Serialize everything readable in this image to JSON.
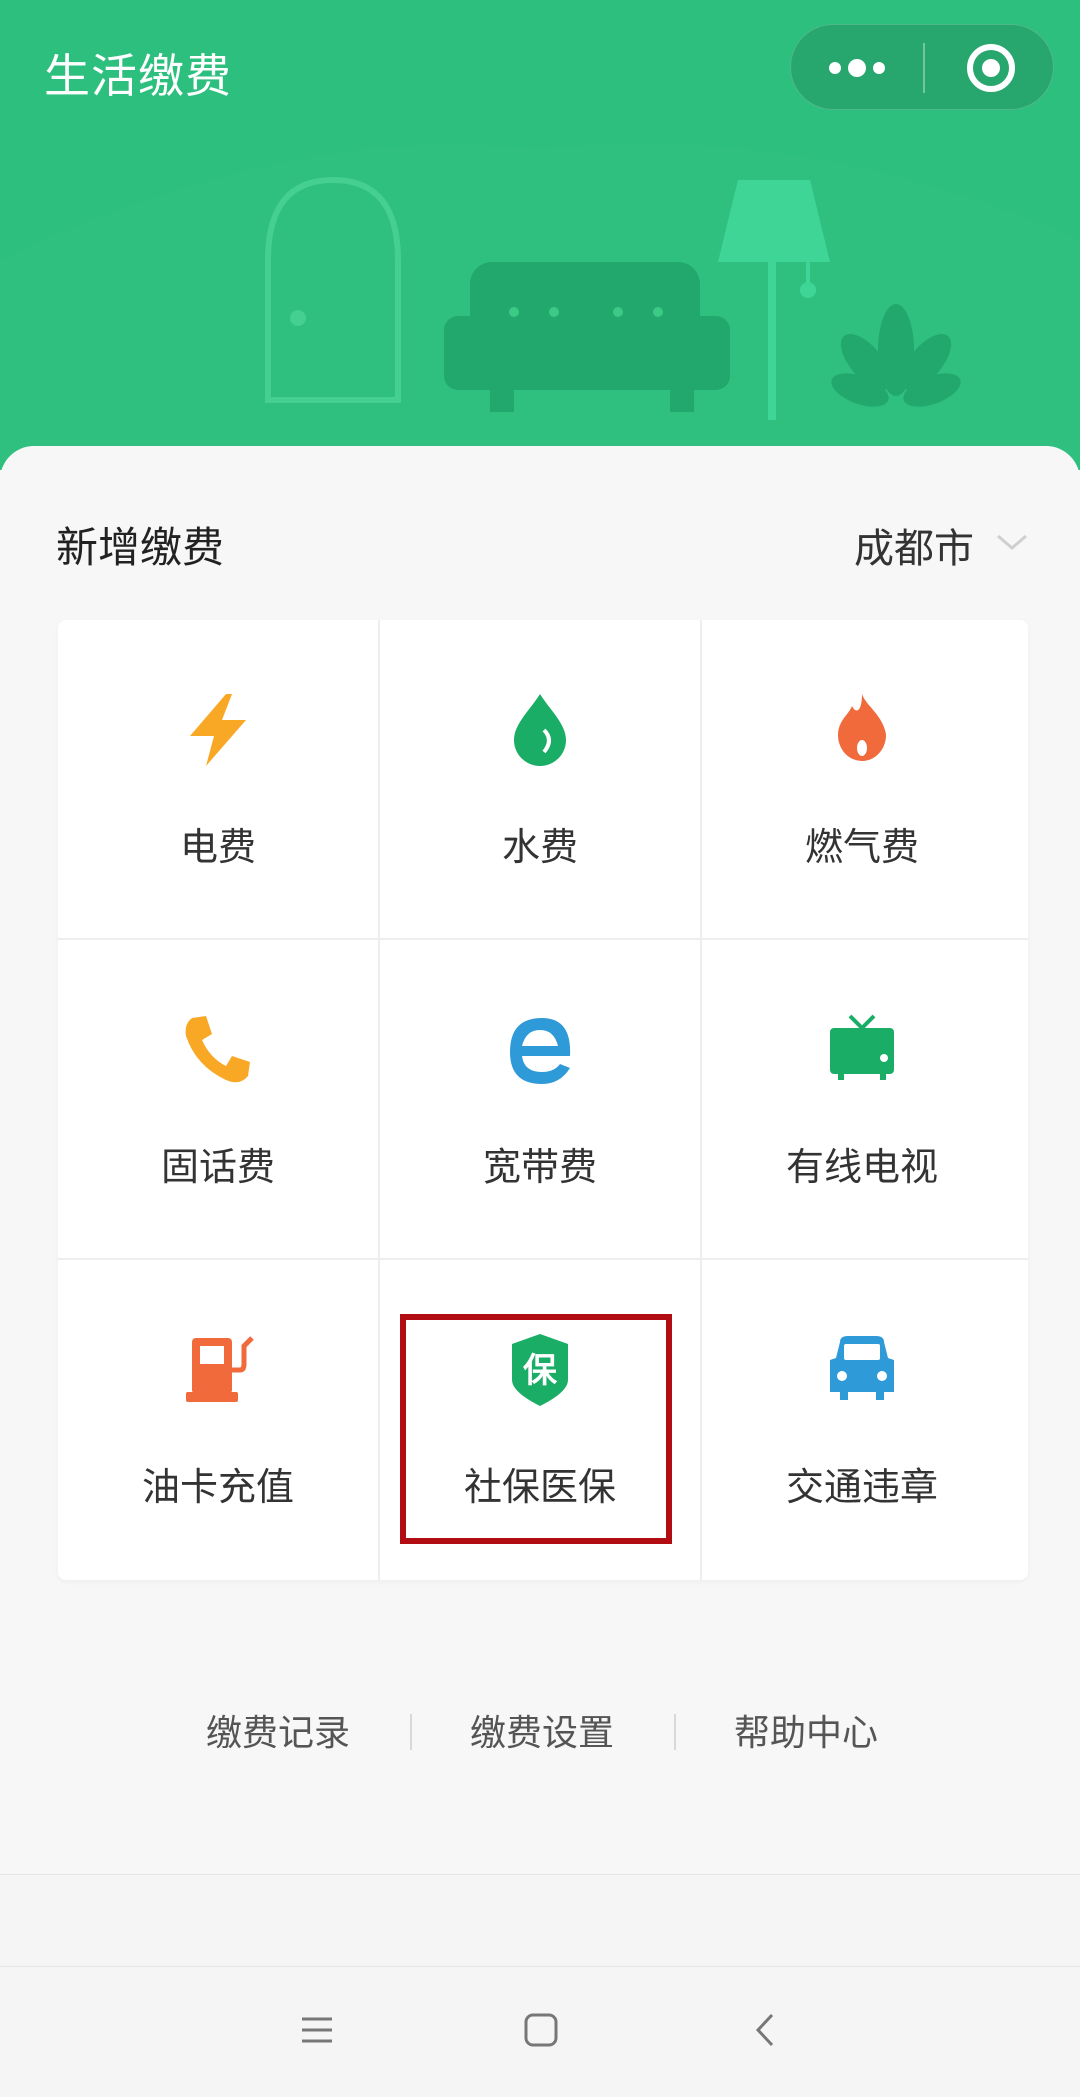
{
  "header": {
    "title": "生活缴费",
    "capsule": {
      "more_icon": "more-dots-icon",
      "close_icon": "target-close-icon"
    }
  },
  "section": {
    "title": "新增缴费",
    "city": "成都市"
  },
  "services": [
    {
      "label": "电费",
      "icon": "lightning-icon",
      "color": "#f9a825"
    },
    {
      "label": "水费",
      "icon": "water-drop-icon",
      "color": "#1aad66"
    },
    {
      "label": "燃气费",
      "icon": "flame-icon",
      "color": "#f06a3c"
    },
    {
      "label": "固话费",
      "icon": "phone-icon",
      "color": "#f9a825"
    },
    {
      "label": "宽带费",
      "icon": "browser-e-icon",
      "color": "#2f9ad8"
    },
    {
      "label": "有线电视",
      "icon": "tv-icon",
      "color": "#1aad66"
    },
    {
      "label": "油卡充值",
      "icon": "fuel-pump-icon",
      "color": "#f06a3c"
    },
    {
      "label": "社保医保",
      "icon": "insurance-shield-icon",
      "icon_text": "保",
      "color": "#1aad66"
    },
    {
      "label": "交通违章",
      "icon": "car-icon",
      "color": "#2f9ad8"
    }
  ],
  "links": [
    {
      "label": "缴费记录"
    },
    {
      "label": "缴费设置"
    },
    {
      "label": "帮助中心"
    }
  ],
  "colors": {
    "brand_green": "#2dbf7e",
    "highlight_red": "#b10d12"
  }
}
